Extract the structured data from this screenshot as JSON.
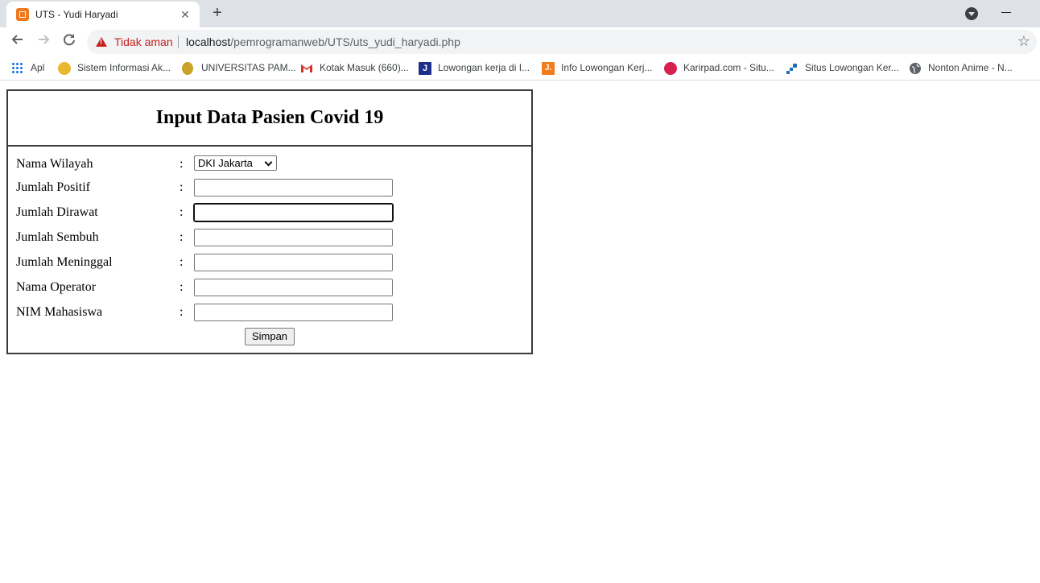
{
  "browser": {
    "tab_title": "UTS - Yudi Haryadi",
    "tab_close": "✕",
    "new_tab": "+",
    "security_label": "Tidak aman",
    "url_host": "localhost",
    "url_path": "/pemrogramanweb/UTS/uts_yudi_haryadi.php",
    "icons": {
      "back": "back-arrow-icon",
      "forward": "forward-arrow-icon",
      "reload": "reload-icon",
      "star": "star-icon"
    }
  },
  "bookmarks": [
    {
      "label": "Apl",
      "icon": "apps-grid-icon",
      "color": "#1a73e8"
    },
    {
      "label": "Sistem Informasi Ak...",
      "icon": "university-logo-icon",
      "color": "#e8b82e"
    },
    {
      "label": "UNIVERSITAS PAM...",
      "icon": "university-seal-icon",
      "color": "#c9a227"
    },
    {
      "label": "Kotak Masuk (660)...",
      "icon": "gmail-icon",
      "color": "#d93025"
    },
    {
      "label": "Lowongan kerja di I...",
      "icon": "jobstreet-icon",
      "color": "#1c2f8c"
    },
    {
      "label": "Info Lowongan Kerj...",
      "icon": "jobs-id-icon",
      "color": "#f07c1c"
    },
    {
      "label": "Karirpad.com - Situ...",
      "icon": "karirpad-icon",
      "color": "#d6204f"
    },
    {
      "label": "Situs Lowongan Ker...",
      "icon": "jobs-site-icon",
      "color": "#1e6fb8"
    },
    {
      "label": "Nonton Anime - N...",
      "icon": "globe-icon",
      "color": "#5f6368"
    }
  ],
  "form": {
    "title": "Input Data Pasien Covid 19",
    "separator": ":",
    "wilayah": {
      "label": "Nama Wilayah",
      "selected": "DKI Jakarta"
    },
    "fields": [
      {
        "label": "Jumlah Positif",
        "value": ""
      },
      {
        "label": "Jumlah Dirawat",
        "value": ""
      },
      {
        "label": "Jumlah Sembuh",
        "value": ""
      },
      {
        "label": "Jumlah Meninggal",
        "value": ""
      },
      {
        "label": "Nama Operator",
        "value": ""
      },
      {
        "label": "NIM Mahasiswa",
        "value": ""
      }
    ],
    "submit_label": "Simpan"
  }
}
